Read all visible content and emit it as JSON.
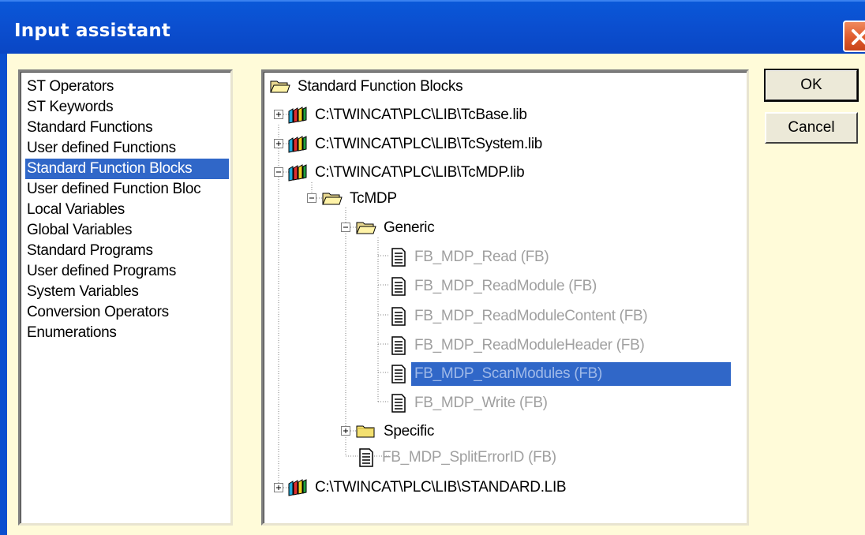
{
  "window": {
    "title": "Input assistant"
  },
  "categories": [
    {
      "label": "ST Operators"
    },
    {
      "label": "ST Keywords"
    },
    {
      "label": "Standard Functions"
    },
    {
      "label": "User defined Functions"
    },
    {
      "label": "Standard Function Blocks",
      "selected": true
    },
    {
      "label": "User defined Function Bloc"
    },
    {
      "label": "Local Variables"
    },
    {
      "label": "Global Variables"
    },
    {
      "label": "Standard Programs"
    },
    {
      "label": "User defined Programs"
    },
    {
      "label": "System Variables"
    },
    {
      "label": "Conversion Operators"
    },
    {
      "label": "Enumerations"
    }
  ],
  "tree": {
    "root": "Standard Function Blocks",
    "nodes": [
      {
        "label": "C:\\TWINCAT\\PLC\\LIB\\TcBase.lib",
        "icon": "library-books-icon",
        "expander": "plus"
      },
      {
        "label": "C:\\TWINCAT\\PLC\\LIB\\TcSystem.lib",
        "icon": "library-books-icon",
        "expander": "plus"
      },
      {
        "label": "C:\\TWINCAT\\PLC\\LIB\\TcMDP.lib",
        "icon": "library-books-icon",
        "expander": "minus"
      },
      {
        "label": "TcMDP",
        "icon": "open-folder-icon",
        "expander": "minus"
      },
      {
        "label": "Generic",
        "icon": "open-folder-icon",
        "expander": "minus"
      },
      {
        "label": "FB_MDP_Read (FB)",
        "icon": "document-icon"
      },
      {
        "label": "FB_MDP_ReadModule (FB)",
        "icon": "document-icon"
      },
      {
        "label": "FB_MDP_ReadModuleContent (FB)",
        "icon": "document-icon"
      },
      {
        "label": "FB_MDP_ReadModuleHeader (FB)",
        "icon": "document-icon"
      },
      {
        "label": "FB_MDP_ScanModules (FB)",
        "icon": "document-icon",
        "selected": true
      },
      {
        "label": "FB_MDP_Write (FB)",
        "icon": "document-icon"
      },
      {
        "label": "Specific",
        "icon": "closed-folder-icon",
        "expander": "plus"
      },
      {
        "label": "FB_MDP_SplitErrorID (FB)",
        "icon": "document-icon"
      },
      {
        "label": "C:\\TWINCAT\\PLC\\LIB\\STANDARD.LIB",
        "icon": "library-books-icon",
        "expander": "plus"
      }
    ]
  },
  "buttons": {
    "ok": "OK",
    "cancel": "Cancel"
  },
  "colors": {
    "titlebar": "#0a4fcf",
    "dialog_bg": "#fffbd9",
    "selection": "#3067c8",
    "close_button": "#df5a2c"
  }
}
